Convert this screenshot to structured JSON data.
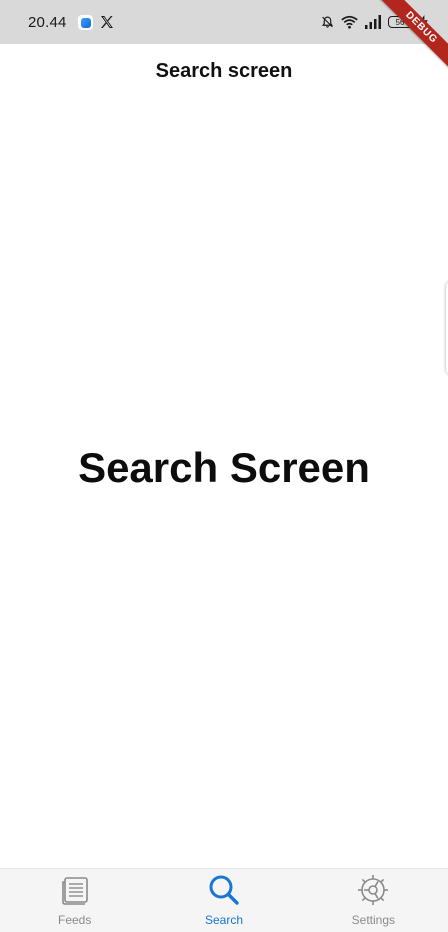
{
  "status_bar": {
    "time": "20.44",
    "battery_level": "56",
    "icons": [
      "app-notification-icon",
      "x-twitter-icon",
      "bell-muted-icon",
      "wifi-icon",
      "signal-icon",
      "battery-icon",
      "charging-bolt-icon"
    ]
  },
  "debug_banner": {
    "label": "DEBUG"
  },
  "app_bar": {
    "title": "Search screen"
  },
  "main": {
    "heading": "Search Screen"
  },
  "bottom_nav": {
    "active_color": "#1976d2",
    "inactive_color": "#8a8a8a",
    "items": [
      {
        "label": "Feeds",
        "icon": "feeds-icon",
        "active": false
      },
      {
        "label": "Search",
        "icon": "search-icon",
        "active": true
      },
      {
        "label": "Settings",
        "icon": "gear-icon",
        "active": false
      }
    ]
  }
}
